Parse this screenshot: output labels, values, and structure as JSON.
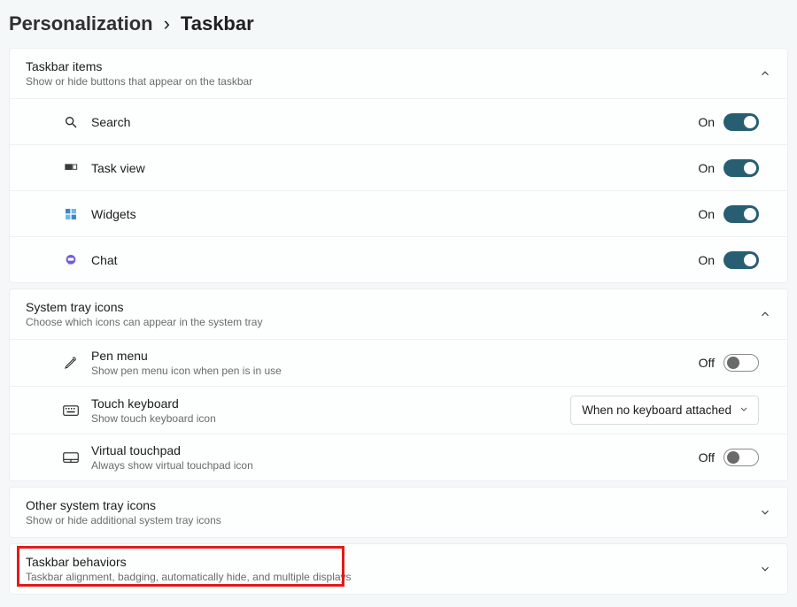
{
  "breadcrumb": {
    "parent": "Personalization",
    "current": "Taskbar",
    "sep": "›"
  },
  "sections": {
    "taskbar_items": {
      "title": "Taskbar items",
      "subtitle": "Show or hide buttons that appear on the taskbar",
      "items": [
        {
          "label": "Search",
          "state": "On"
        },
        {
          "label": "Task view",
          "state": "On"
        },
        {
          "label": "Widgets",
          "state": "On"
        },
        {
          "label": "Chat",
          "state": "On"
        }
      ]
    },
    "system_tray": {
      "title": "System tray icons",
      "subtitle": "Choose which icons can appear in the system tray",
      "items": [
        {
          "label": "Pen menu",
          "sub": "Show pen menu icon when pen is in use",
          "control": "toggle",
          "state": "Off"
        },
        {
          "label": "Touch keyboard",
          "sub": "Show touch keyboard icon",
          "control": "select",
          "select_value": "When no keyboard attached"
        },
        {
          "label": "Virtual touchpad",
          "sub": "Always show virtual touchpad icon",
          "control": "toggle",
          "state": "Off"
        }
      ]
    },
    "other_tray": {
      "title": "Other system tray icons",
      "subtitle": "Show or hide additional system tray icons"
    },
    "behaviors": {
      "title": "Taskbar behaviors",
      "subtitle": "Taskbar alignment, badging, automatically hide, and multiple displays"
    }
  }
}
